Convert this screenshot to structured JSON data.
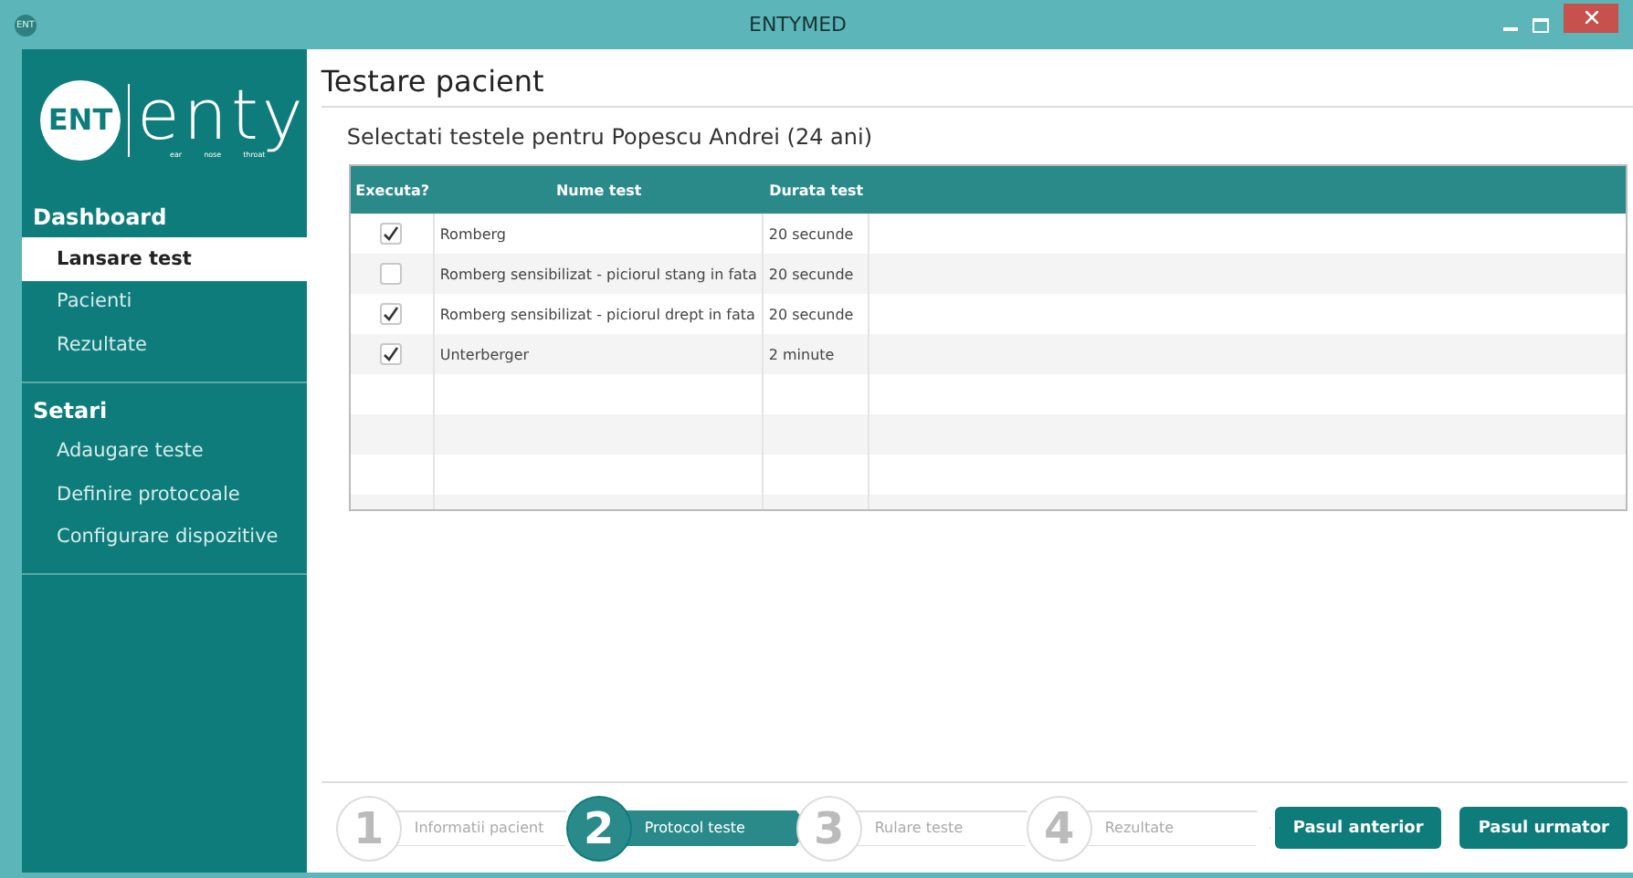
{
  "window": {
    "title": "ENTYMED",
    "app_icon": "ENT"
  },
  "logo": {
    "badge": "ENT",
    "name": "enty",
    "tagline": [
      "ear",
      "nose",
      "throat"
    ]
  },
  "sidebar": {
    "sections": [
      {
        "title": "Dashboard",
        "items": [
          {
            "label": "Lansare test",
            "selected": true
          },
          {
            "label": "Pacienti",
            "selected": false
          },
          {
            "label": "Rezultate",
            "selected": false
          }
        ]
      },
      {
        "title": "Setari",
        "items": [
          {
            "label": "Adaugare teste",
            "selected": false
          },
          {
            "label": "Definire protocoale",
            "selected": false
          },
          {
            "label": "Configurare dispozitive",
            "selected": false
          }
        ]
      }
    ]
  },
  "page": {
    "title": "Testare pacient",
    "subtitle": "Selectati testele pentru Popescu Andrei (24 ani)"
  },
  "table": {
    "columns": [
      "Executa?",
      "Nume test",
      "Durata test"
    ],
    "rows": [
      {
        "checked": true,
        "name": "Romberg",
        "duration": "20 secunde"
      },
      {
        "checked": false,
        "name": "Romberg sensibilizat - piciorul stang in fata",
        "duration": "20 secunde"
      },
      {
        "checked": true,
        "name": "Romberg sensibilizat - piciorul drept in fata",
        "duration": "20 secunde"
      },
      {
        "checked": true,
        "name": "Unterberger",
        "duration": "2 minute"
      }
    ]
  },
  "steps": [
    {
      "number": "1",
      "label": "Informatii pacient",
      "selected": false
    },
    {
      "number": "2",
      "label": "Protocol teste",
      "selected": true
    },
    {
      "number": "3",
      "label": "Rulare teste",
      "selected": false
    },
    {
      "number": "4",
      "label": "Rezultate",
      "selected": false
    }
  ],
  "buttons": [
    "Pasul anterior",
    "Pasul urmator"
  ]
}
